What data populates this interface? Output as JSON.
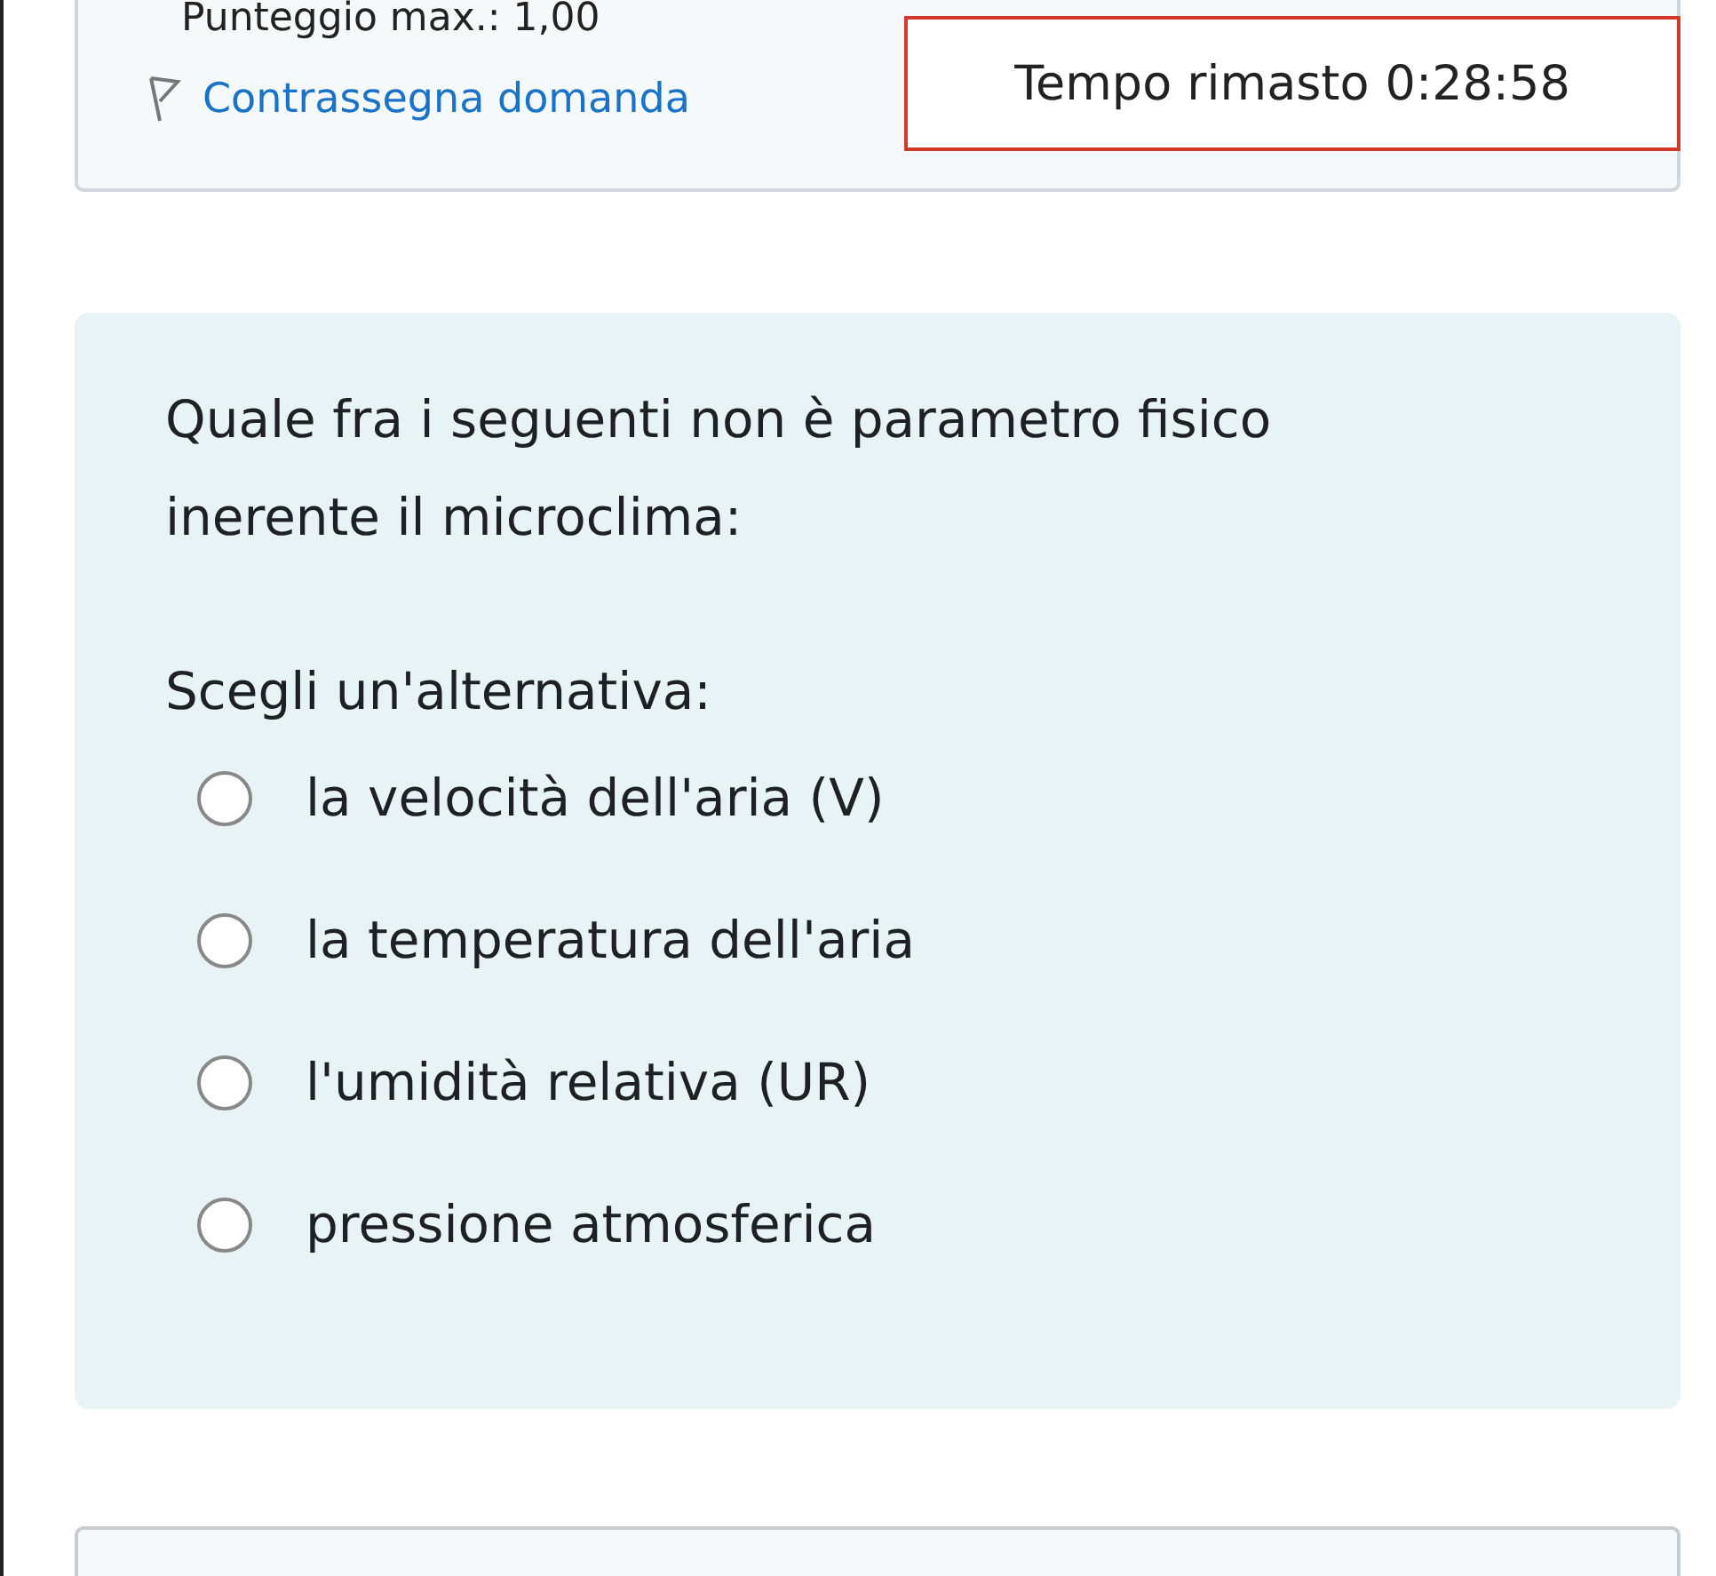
{
  "info": {
    "points": "Punteggio max.: 1,00",
    "flag_link": "Contrassegna domanda"
  },
  "timer": {
    "label": "Tempo rimasto",
    "value": "0:28:58"
  },
  "question": {
    "text": "Quale fra i seguenti non è parametro fisico inerente il microclima:",
    "prompt": "Scegli un'alternativa:",
    "options": [
      {
        "label": "la velocità dell'aria (V)",
        "selected": false
      },
      {
        "label": "la temperatura dell'aria",
        "selected": false
      },
      {
        "label": "l'umidità relativa (UR)",
        "selected": false
      },
      {
        "label": "pressione atmosferica",
        "selected": false
      }
    ]
  }
}
